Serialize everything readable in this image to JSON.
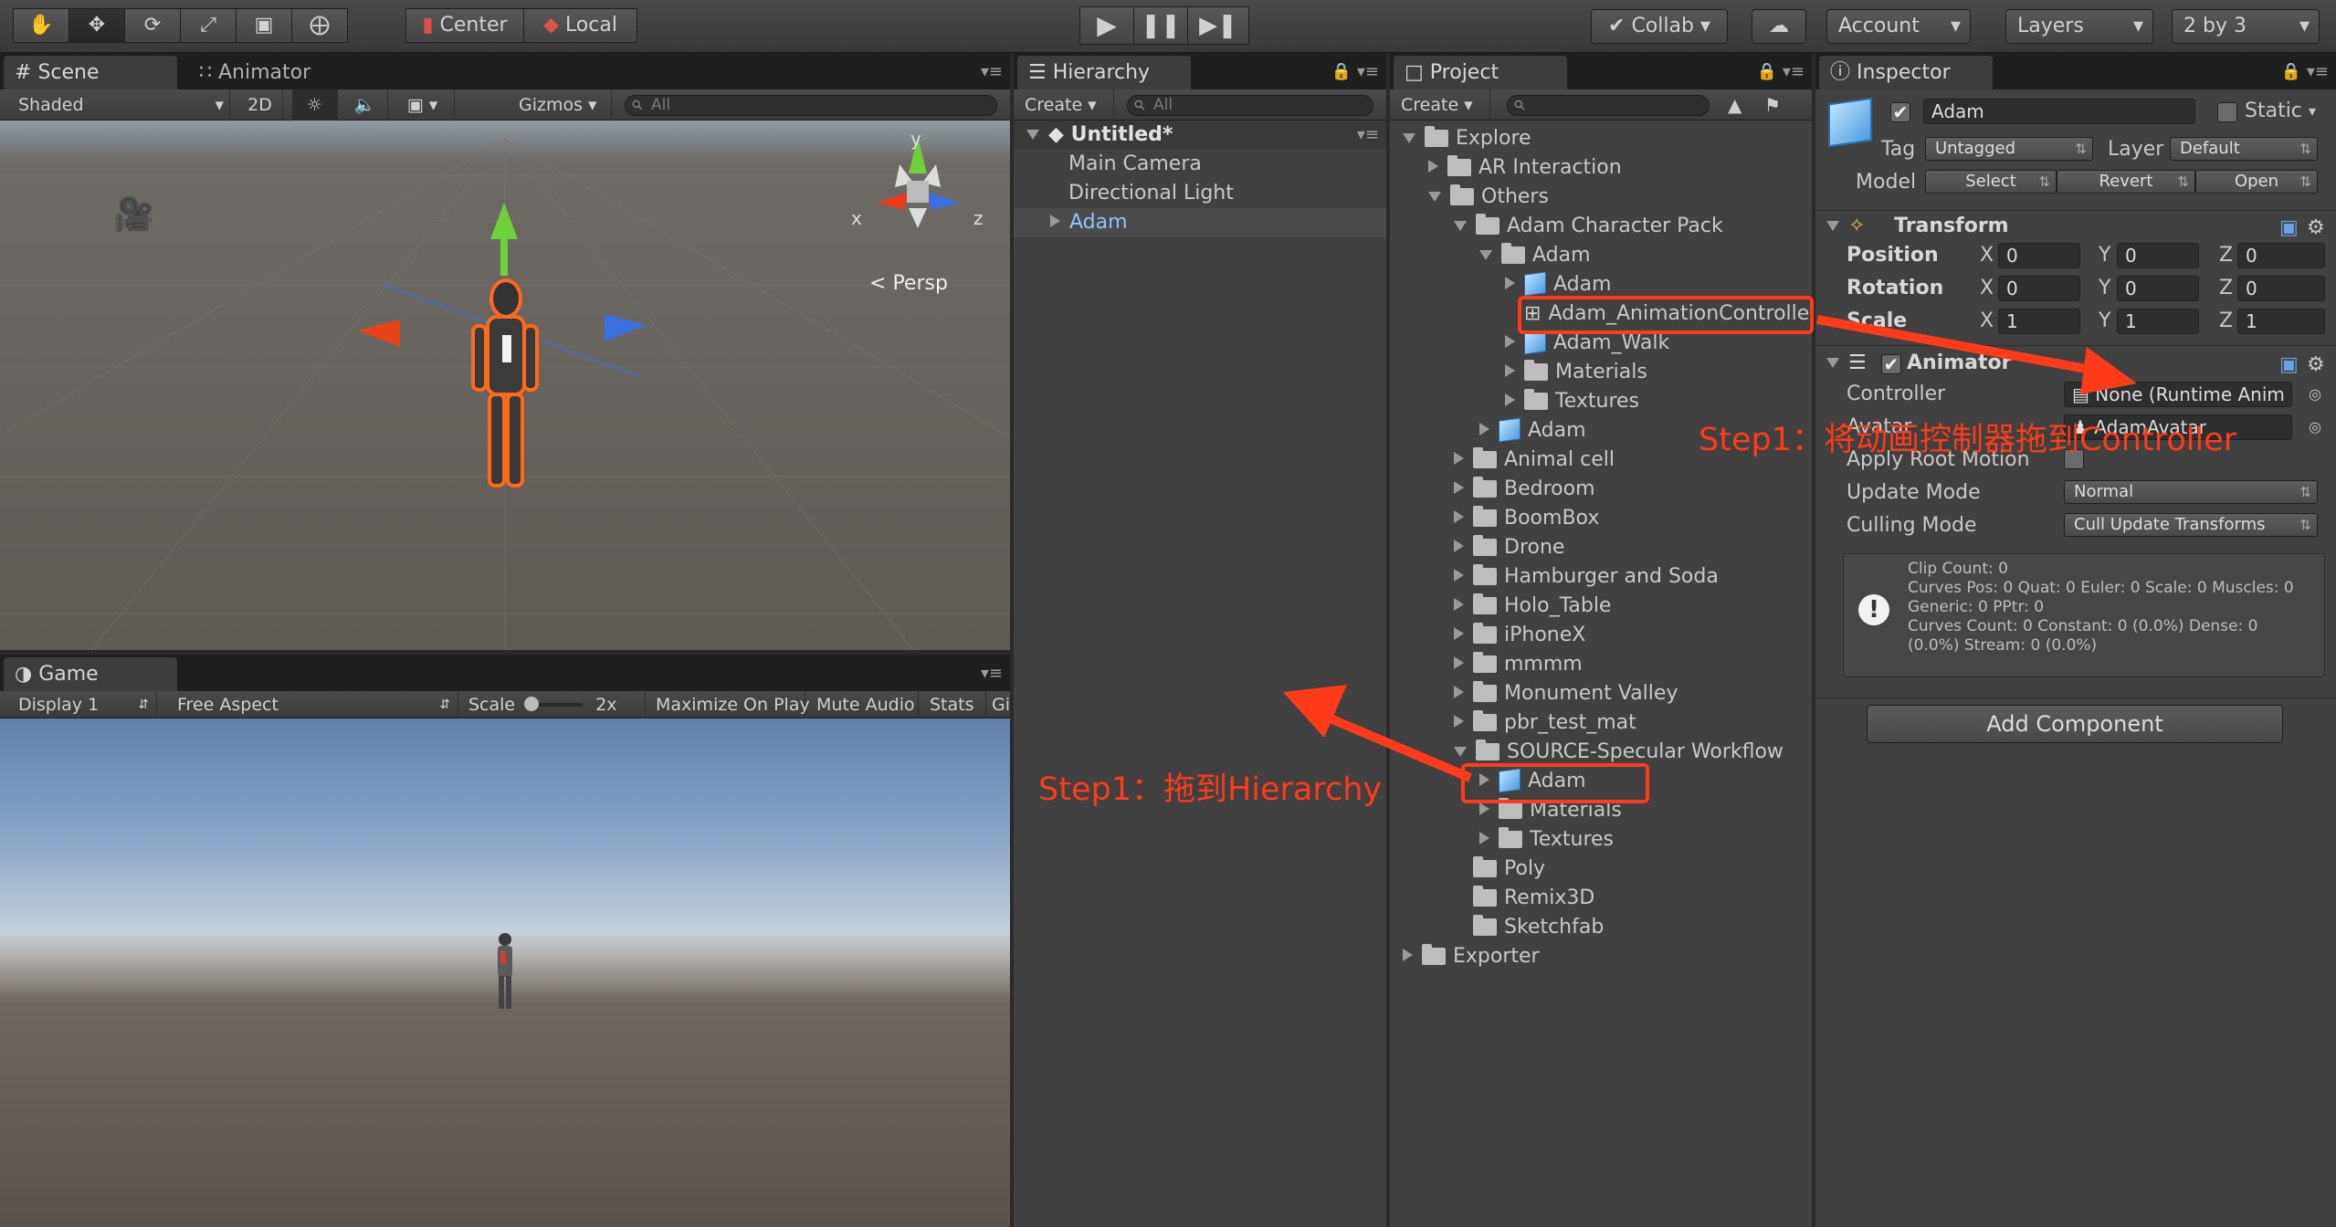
{
  "toolbar": {
    "pivot_center": "Center",
    "pivot_local": "Local",
    "collab": "Collab",
    "account": "Account",
    "layers": "Layers",
    "layout": "2 by 3"
  },
  "scene": {
    "tab": "Scene",
    "animator_tab": "Animator",
    "shading": "Shaded",
    "mode_2d": "2D",
    "gizmos": "Gizmos",
    "search_placeholder": "All",
    "persp_label": "Persp",
    "axis_x": "x",
    "axis_y": "y",
    "axis_z": "z"
  },
  "game": {
    "tab": "Game",
    "display": "Display 1",
    "aspect": "Free Aspect",
    "scale_label": "Scale",
    "scale_value": "2x",
    "maximize": "Maximize On Play",
    "mute": "Mute Audio",
    "stats": "Stats",
    "gizmos_trunc": "Gi"
  },
  "hierarchy": {
    "tab": "Hierarchy",
    "create": "Create",
    "search_placeholder": "All",
    "scene_name": "Untitled*",
    "items": [
      "Main Camera",
      "Directional Light",
      "Adam"
    ]
  },
  "project": {
    "tab": "Project",
    "create": "Create",
    "tree": [
      {
        "label": "Explore",
        "indent": 0,
        "icon": "folder",
        "arrow": "down"
      },
      {
        "label": "AR Interaction",
        "indent": 1,
        "icon": "folder",
        "arrow": "right"
      },
      {
        "label": "Others",
        "indent": 1,
        "icon": "folder",
        "arrow": "down"
      },
      {
        "label": "Adam Character Pack",
        "indent": 2,
        "icon": "folder",
        "arrow": "down"
      },
      {
        "label": "Adam",
        "indent": 3,
        "icon": "folder",
        "arrow": "down"
      },
      {
        "label": "Adam",
        "indent": 4,
        "icon": "prefab",
        "arrow": "right"
      },
      {
        "label": "Adam_AnimationController",
        "indent": 4,
        "icon": "animator-controller",
        "arrow": "none"
      },
      {
        "label": "Adam_Walk",
        "indent": 4,
        "icon": "prefab",
        "arrow": "right"
      },
      {
        "label": "Materials",
        "indent": 4,
        "icon": "folder",
        "arrow": "right"
      },
      {
        "label": "Textures",
        "indent": 4,
        "icon": "folder",
        "arrow": "right"
      },
      {
        "label": "Adam",
        "indent": 3,
        "icon": "prefab",
        "arrow": "right"
      },
      {
        "label": "Animal cell",
        "indent": 2,
        "icon": "folder",
        "arrow": "right"
      },
      {
        "label": "Bedroom",
        "indent": 2,
        "icon": "folder",
        "arrow": "right"
      },
      {
        "label": "BoomBox",
        "indent": 2,
        "icon": "folder",
        "arrow": "right"
      },
      {
        "label": "Drone",
        "indent": 2,
        "icon": "folder",
        "arrow": "right"
      },
      {
        "label": "Hamburger and Soda",
        "indent": 2,
        "icon": "folder",
        "arrow": "right"
      },
      {
        "label": "Holo_Table",
        "indent": 2,
        "icon": "folder",
        "arrow": "right"
      },
      {
        "label": "iPhoneX",
        "indent": 2,
        "icon": "folder",
        "arrow": "right"
      },
      {
        "label": "mmmm",
        "indent": 2,
        "icon": "folder",
        "arrow": "right"
      },
      {
        "label": "Monument Valley",
        "indent": 2,
        "icon": "folder",
        "arrow": "right"
      },
      {
        "label": "pbr_test_mat",
        "indent": 2,
        "icon": "folder",
        "arrow": "right"
      },
      {
        "label": "SOURCE-Specular Workflow",
        "indent": 2,
        "icon": "folder",
        "arrow": "down"
      },
      {
        "label": "Adam",
        "indent": 3,
        "icon": "prefab",
        "arrow": "right"
      },
      {
        "label": "Materials",
        "indent": 3,
        "icon": "folder",
        "arrow": "right"
      },
      {
        "label": "Textures",
        "indent": 3,
        "icon": "folder",
        "arrow": "right"
      },
      {
        "label": "Poly",
        "indent": 2,
        "icon": "folder",
        "arrow": "none"
      },
      {
        "label": "Remix3D",
        "indent": 2,
        "icon": "folder",
        "arrow": "none"
      },
      {
        "label": "Sketchfab",
        "indent": 2,
        "icon": "folder",
        "arrow": "none"
      },
      {
        "label": "Exporter",
        "indent": 0,
        "icon": "folder",
        "arrow": "right"
      }
    ]
  },
  "inspector": {
    "tab": "Inspector",
    "object_name": "Adam",
    "static_label": "Static",
    "tag_label": "Tag",
    "tag_value": "Untagged",
    "layer_label": "Layer",
    "layer_value": "Default",
    "model_label": "Model",
    "model_select": "Select",
    "model_revert": "Revert",
    "model_open": "Open",
    "transform_title": "Transform",
    "position_label": "Position",
    "rotation_label": "Rotation",
    "scale_label": "Scale",
    "position": {
      "x": "0",
      "y": "0",
      "z": "0"
    },
    "rotation": {
      "x": "0",
      "y": "0",
      "z": "0"
    },
    "scale": {
      "x": "1",
      "y": "1",
      "z": "1"
    },
    "axis_x": "X",
    "axis_y": "Y",
    "axis_z": "Z",
    "animator_title": "Animator",
    "controller_label": "Controller",
    "controller_value": "None (Runtime Anim",
    "avatar_label": "Avatar",
    "avatar_value": "AdamAvatar",
    "apply_root_motion_label": "Apply Root Motion",
    "update_mode_label": "Update Mode",
    "update_mode_value": "Normal",
    "culling_mode_label": "Culling Mode",
    "culling_mode_value": "Cull Update Transforms",
    "info_lines": [
      "Clip Count: 0",
      "Curves Pos: 0 Quat: 0 Euler: 0 Scale: 0 Muscles: 0",
      "Generic: 0 PPtr: 0",
      "Curves Count: 0 Constant: 0 (0.0%) Dense: 0",
      "(0.0%) Stream: 0 (0.0%)"
    ],
    "add_component": "Add Component"
  },
  "annotations": {
    "step_hierarchy": "Step1：拖到Hierarchy",
    "step_controller": "Step1：将动画控制器拖到Controller",
    "color": "#ff3b1a"
  }
}
